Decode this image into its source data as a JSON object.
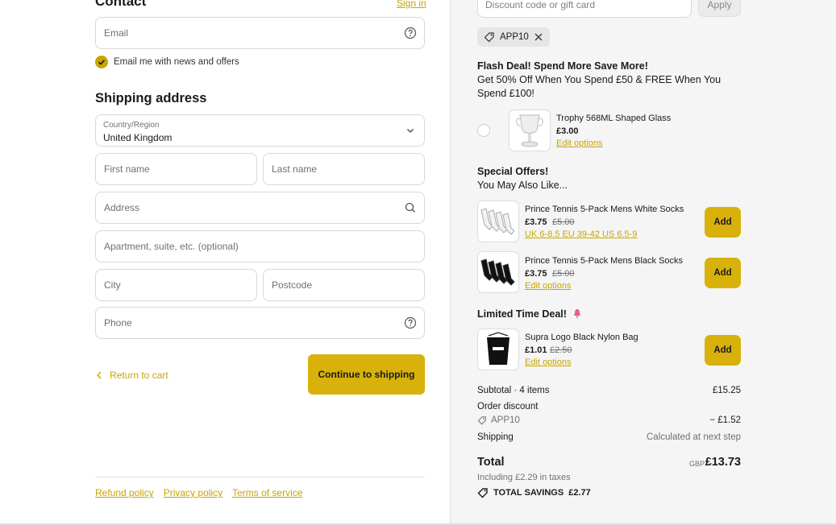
{
  "contact": {
    "heading": "Contact",
    "sign_in": "Sign in",
    "email_placeholder": "Email",
    "news_label": "Email me with news and offers"
  },
  "shipping": {
    "heading": "Shipping address",
    "country_label": "Country/Region",
    "country_value": "United Kingdom",
    "first_name_placeholder": "First name",
    "last_name_placeholder": "Last name",
    "address_placeholder": "Address",
    "apartment_placeholder": "Apartment, suite, etc. (optional)",
    "city_placeholder": "City",
    "postcode_placeholder": "Postcode",
    "phone_placeholder": "Phone"
  },
  "actions": {
    "return_label": "Return to cart",
    "continue_label": "Continue to shipping"
  },
  "footer": {
    "links": [
      "Refund policy",
      "Privacy policy",
      "Terms of service"
    ]
  },
  "summary": {
    "discount_placeholder": "Discount code or gift card",
    "apply_label": "Apply",
    "applied_code": "APP10",
    "flash": {
      "title": "Flash Deal! Spend More Save More!",
      "text": "Get 50% Off When You Spend £50 & FREE When You Spend £100!",
      "product": {
        "name": "Trophy 568ML Shaped Glass",
        "price": "£3.00",
        "link": "Edit options"
      }
    },
    "special": {
      "title": "Special Offers!",
      "subtitle": "You May Also Like...",
      "products": [
        {
          "name": "Prince Tennis 5-Pack Mens White Socks",
          "price": "£3.75",
          "old_price": "£5.00",
          "link": "UK 6-8.5 EU 39-42 US 6.5-9",
          "button": "Add"
        },
        {
          "name": "Prince Tennis 5-Pack Mens Black Socks",
          "price": "£3.75",
          "old_price": "£5.00",
          "link": "Edit options",
          "button": "Add"
        }
      ]
    },
    "limited": {
      "title": "Limited Time Deal!",
      "product": {
        "name": "Supra Logo Black Nylon Bag",
        "price": "£1.01",
        "old_price": "£2.50",
        "link": "Edit options",
        "button": "Add"
      }
    },
    "totals": {
      "subtotal_label": "Subtotal · 4 items",
      "subtotal_value": "£15.25",
      "order_discount_label": "Order discount",
      "discount_code": "APP10",
      "discount_value": "− £1.52",
      "shipping_label": "Shipping",
      "shipping_value": "Calculated at next step",
      "total_label": "Total",
      "currency": "GBP",
      "total_value": "£13.73",
      "taxes": "Including £2.29 in taxes",
      "savings_label": "TOTAL SAVINGS",
      "savings_value": "£2.77"
    }
  },
  "colors": {
    "accent": "#d8b20a",
    "link": "#c7a600",
    "panel": "#f5f5f5"
  },
  "icons": [
    "help-icon",
    "check-icon",
    "chevron-down-icon",
    "search-icon",
    "chevron-left-icon",
    "tag-icon",
    "close-icon"
  ]
}
